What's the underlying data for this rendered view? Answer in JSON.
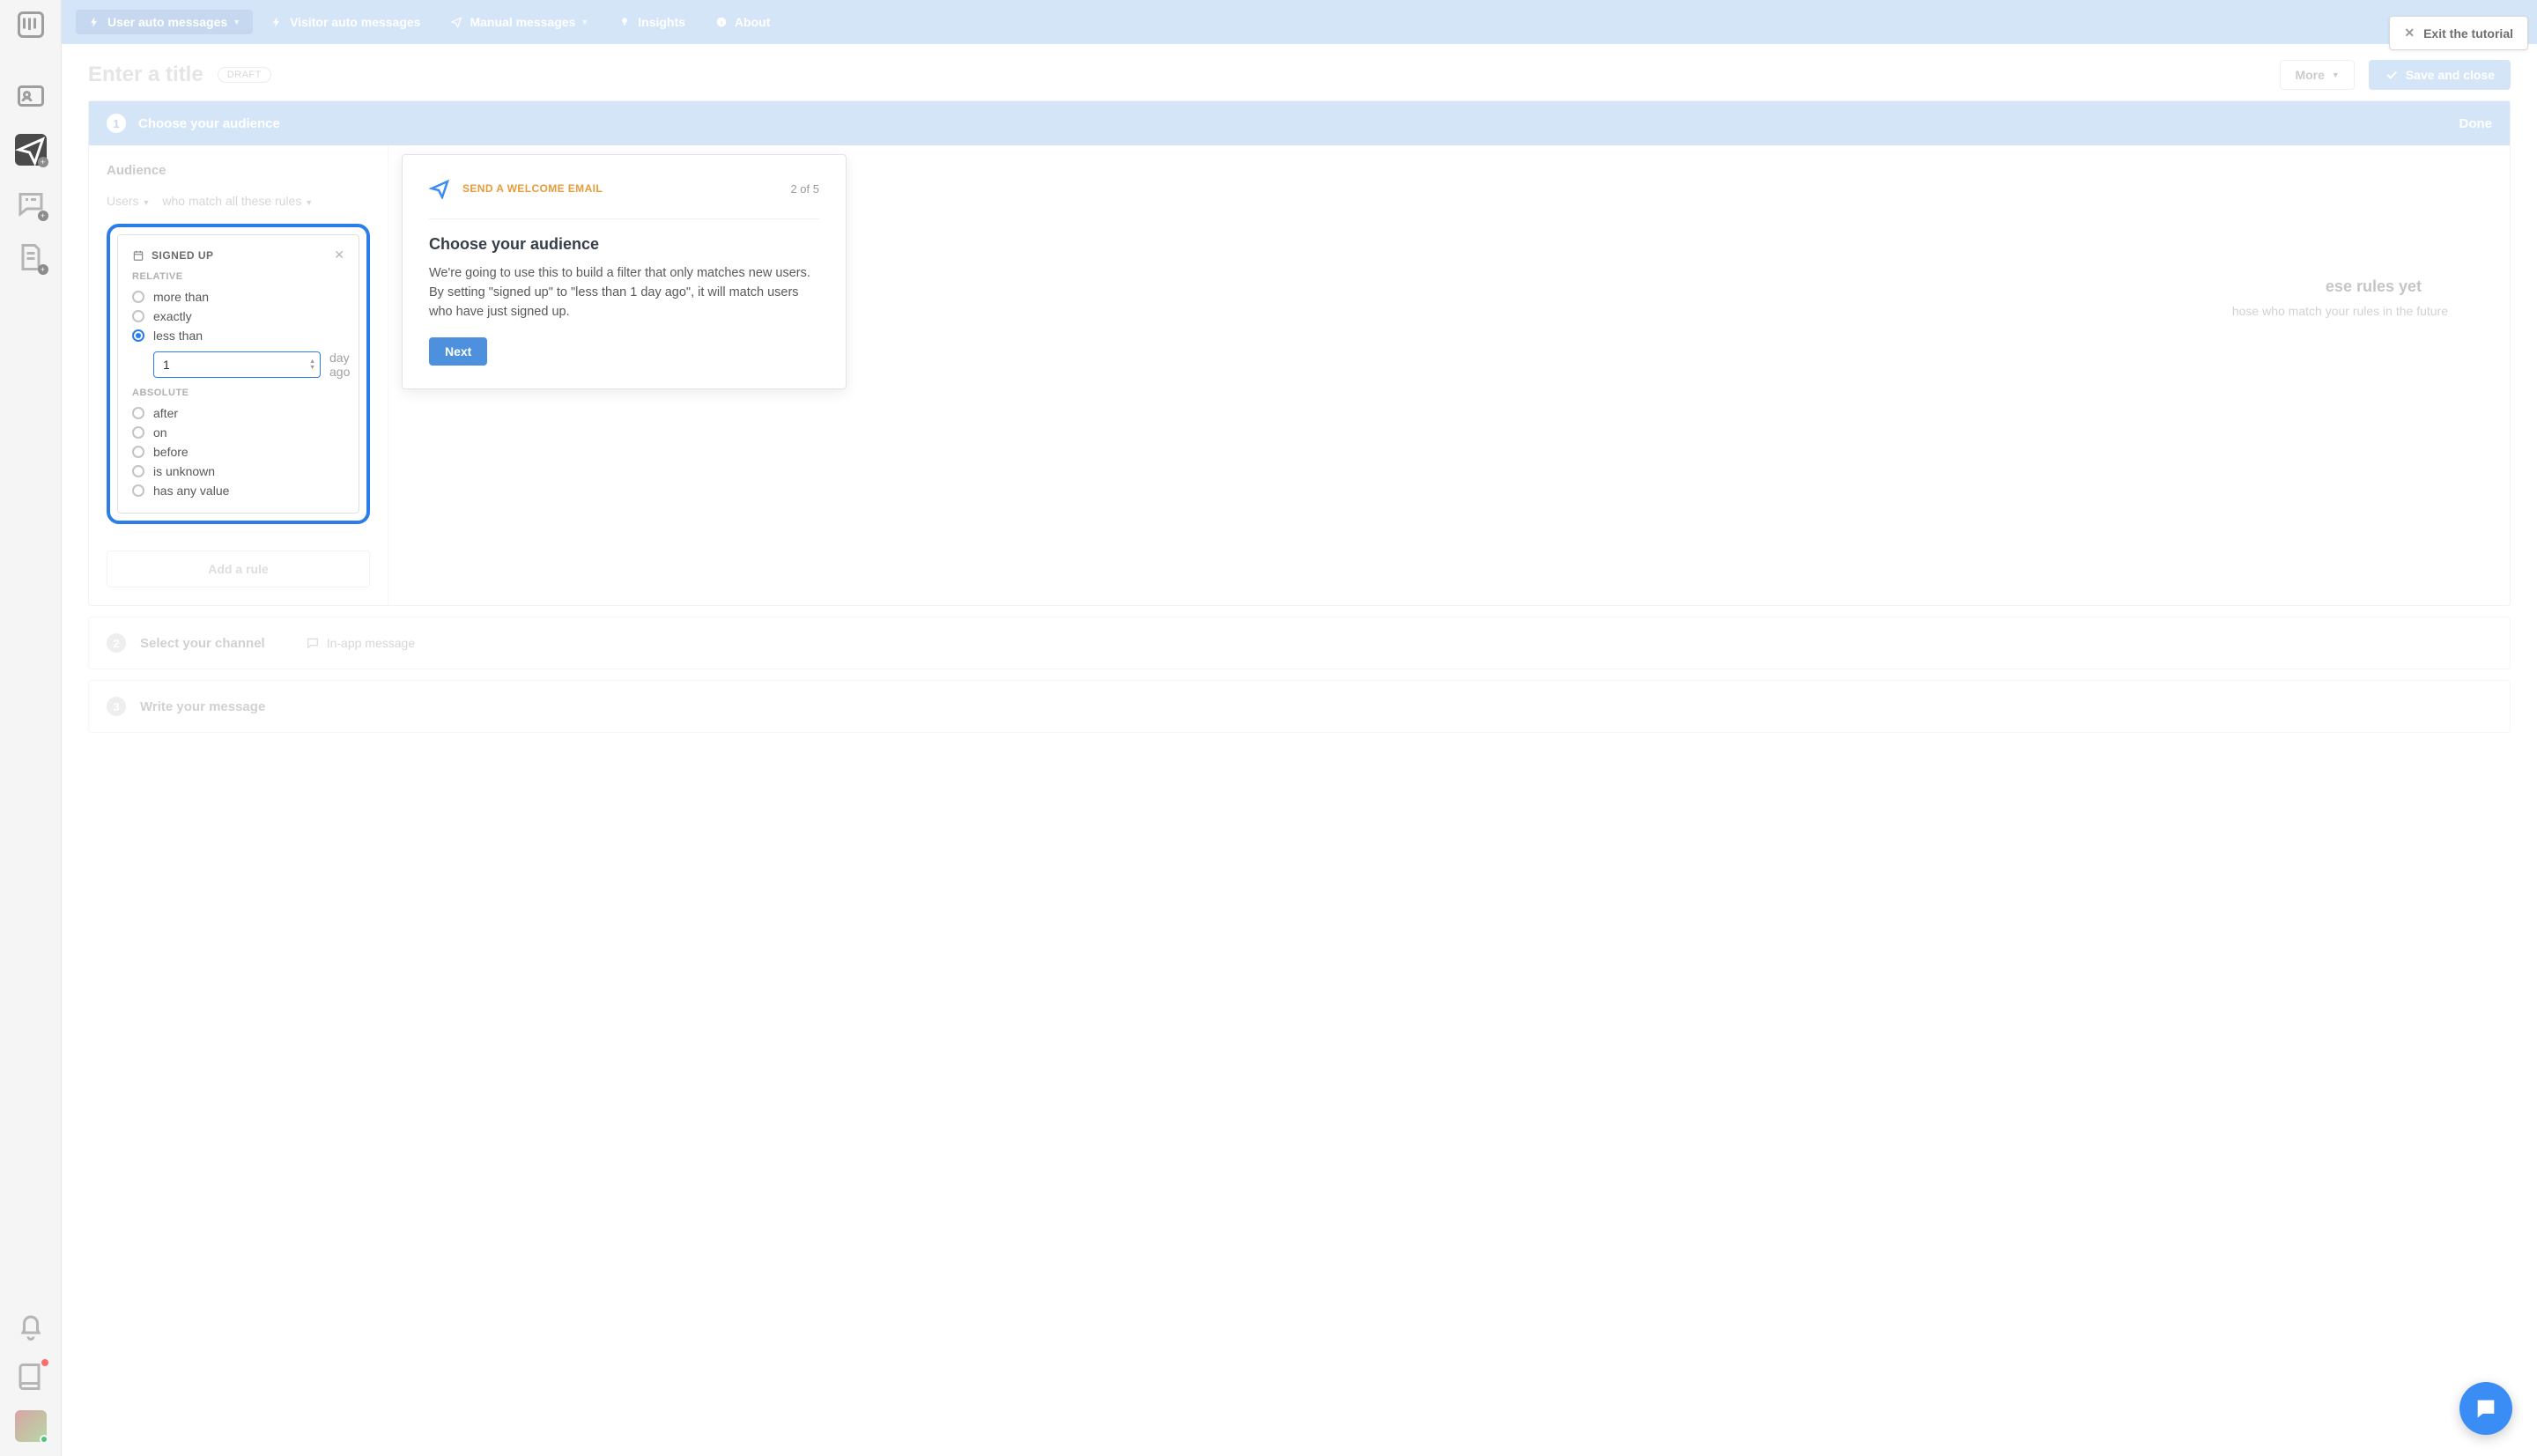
{
  "topbar": {
    "tabs": [
      {
        "label": "User auto messages"
      },
      {
        "label": "Visitor auto messages"
      },
      {
        "label": "Manual messages"
      },
      {
        "label": "Insights"
      },
      {
        "label": "About"
      }
    ],
    "exit_tutorial": "Exit the tutorial"
  },
  "header": {
    "title_placeholder": "Enter a title",
    "draft_badge": "DRAFT",
    "more": "More",
    "save": "Save and close"
  },
  "step1": {
    "label": "Choose your audience",
    "done": "Done",
    "audience_label": "Audience",
    "filter_subject": "Users",
    "filter_clause": "who match all these rules",
    "rule": {
      "title": "SIGNED UP",
      "section_relative": "RELATIVE",
      "relative_options": [
        "more than",
        "exactly",
        "less than"
      ],
      "selected_relative": "less than",
      "value": "1",
      "unit": "day ago",
      "section_absolute": "ABSOLUTE",
      "absolute_options": [
        "after",
        "on",
        "before",
        "is unknown",
        "has any value"
      ]
    },
    "add_rule": "Add a rule",
    "empty_title": "ese rules yet",
    "empty_sub": "hose who match your rules in the future"
  },
  "tutorial": {
    "kicker": "SEND A WELCOME EMAIL",
    "step": "2 of 5",
    "title": "Choose your audience",
    "body": "We're going to use this to build a filter that only matches new users. By setting \"signed up\" to \"less than 1 day ago\", it will match users who have just signed up.",
    "next": "Next"
  },
  "step2": {
    "label": "Select your channel",
    "channel": "In-app message"
  },
  "step3": {
    "label": "Write your message"
  }
}
